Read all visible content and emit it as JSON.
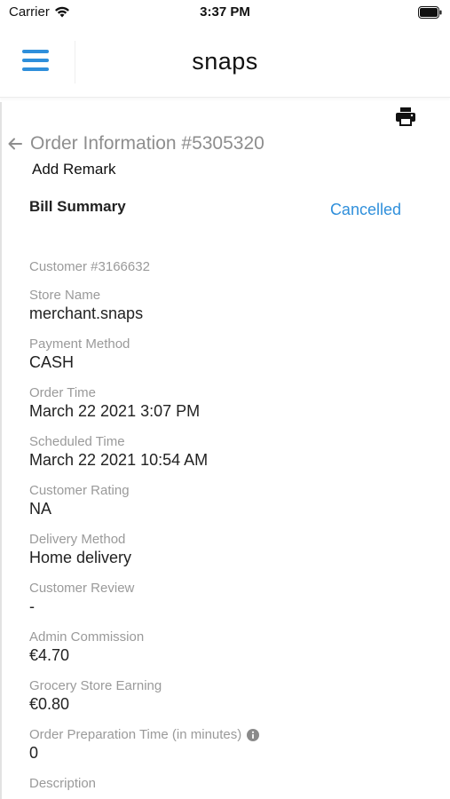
{
  "status_bar": {
    "carrier": "Carrier",
    "time": "3:37 PM"
  },
  "header": {
    "brand": "snaps",
    "menu_icon": "hamburger-menu-icon"
  },
  "order": {
    "title": "Order Information #5305320",
    "add_remark": "Add Remark",
    "bill_summary": "Bill Summary",
    "status": "Cancelled",
    "customer": "Customer #3166632"
  },
  "fields": [
    {
      "label": "Store Name",
      "value": "merchant.snaps"
    },
    {
      "label": "Payment Method",
      "value": "CASH"
    },
    {
      "label": "Order Time",
      "value": "March 22 2021 3:07 PM"
    },
    {
      "label": "Scheduled Time",
      "value": "March 22 2021 10:54 AM"
    },
    {
      "label": "Customer Rating",
      "value": "NA"
    },
    {
      "label": "Delivery Method",
      "value": "Home delivery"
    },
    {
      "label": "Customer Review",
      "value": "-"
    },
    {
      "label": "Admin Commission",
      "value": "€4.70"
    },
    {
      "label": "Grocery Store Earning",
      "value": "€0.80"
    },
    {
      "label": "Order Preparation Time (in minutes)",
      "value": "0"
    },
    {
      "label": "Description",
      "value": ""
    }
  ],
  "colors": {
    "accent": "#2f8fdb",
    "muted": "#9a9a9a"
  }
}
